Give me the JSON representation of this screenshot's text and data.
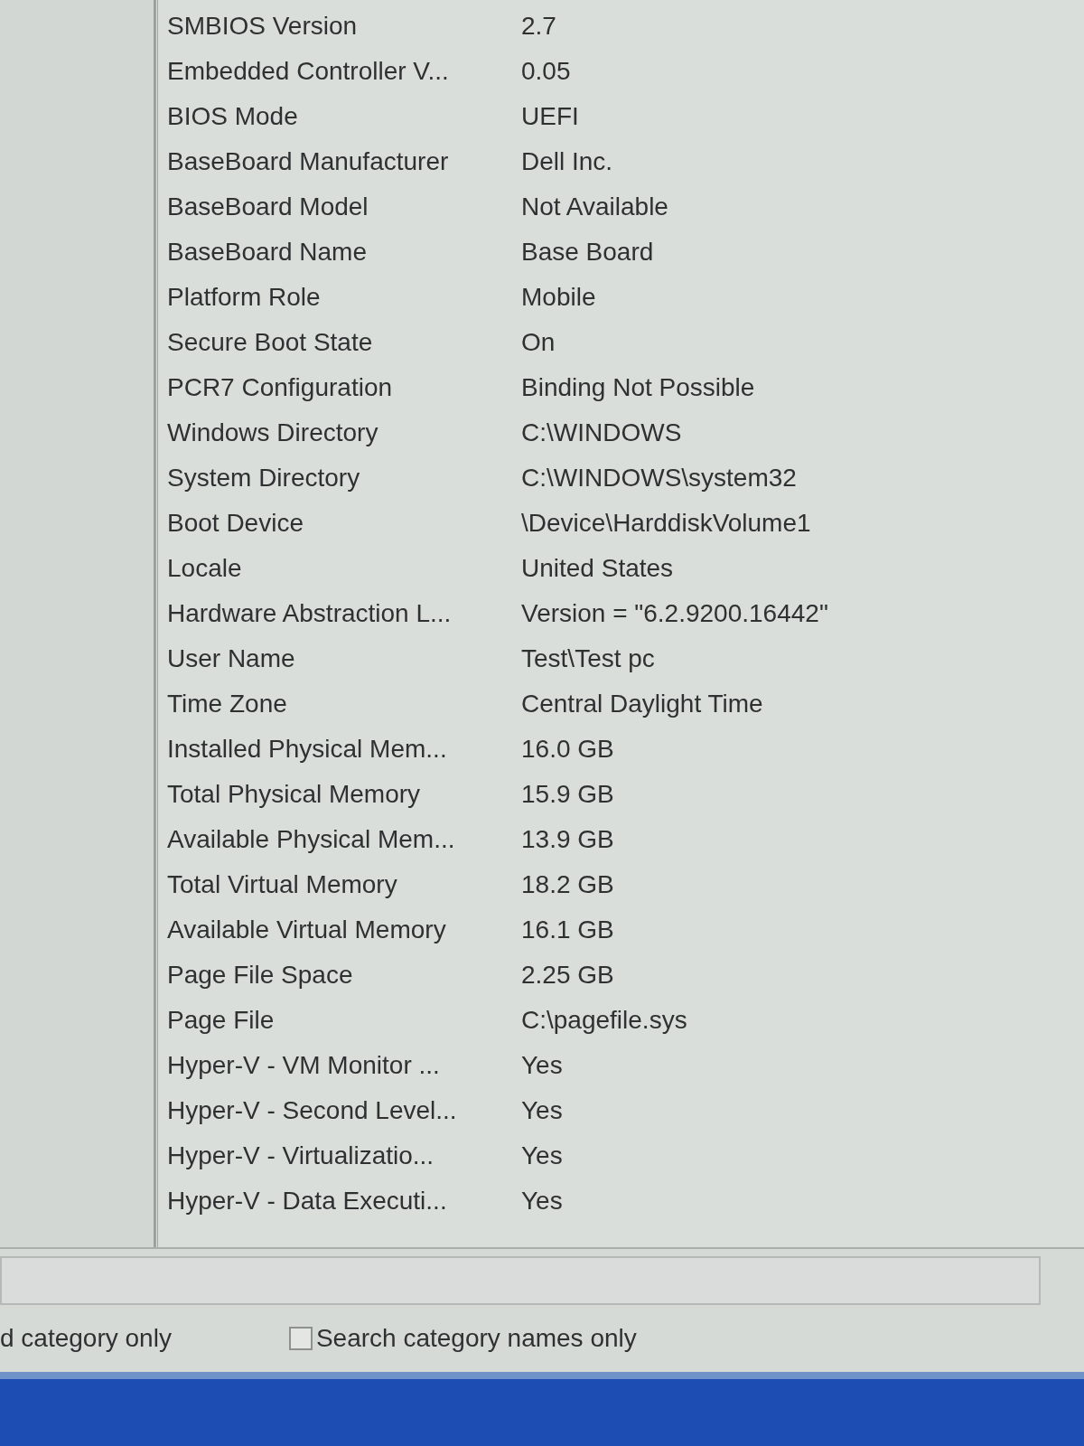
{
  "details": {
    "rows": [
      {
        "item": "SMBIOS Version",
        "value": "2.7"
      },
      {
        "item": "Embedded Controller V...",
        "value": "0.05"
      },
      {
        "item": "BIOS Mode",
        "value": "UEFI"
      },
      {
        "item": "BaseBoard Manufacturer",
        "value": "Dell Inc."
      },
      {
        "item": "BaseBoard Model",
        "value": "Not Available"
      },
      {
        "item": "BaseBoard Name",
        "value": "Base Board"
      },
      {
        "item": "Platform Role",
        "value": "Mobile"
      },
      {
        "item": "Secure Boot State",
        "value": "On"
      },
      {
        "item": "PCR7 Configuration",
        "value": "Binding Not Possible"
      },
      {
        "item": "Windows Directory",
        "value": "C:\\WINDOWS"
      },
      {
        "item": "System Directory",
        "value": "C:\\WINDOWS\\system32"
      },
      {
        "item": "Boot Device",
        "value": "\\Device\\HarddiskVolume1"
      },
      {
        "item": "Locale",
        "value": "United States"
      },
      {
        "item": "Hardware Abstraction L...",
        "value": "Version = \"6.2.9200.16442\""
      },
      {
        "item": "User Name",
        "value": "Test\\Test pc"
      },
      {
        "item": "Time Zone",
        "value": "Central Daylight Time"
      },
      {
        "item": "Installed Physical Mem...",
        "value": "16.0 GB"
      },
      {
        "item": "Total Physical Memory",
        "value": "15.9 GB"
      },
      {
        "item": "Available Physical Mem...",
        "value": "13.9 GB"
      },
      {
        "item": "Total Virtual Memory",
        "value": "18.2 GB"
      },
      {
        "item": "Available Virtual Memory",
        "value": "16.1 GB"
      },
      {
        "item": "Page File Space",
        "value": "2.25 GB"
      },
      {
        "item": "Page File",
        "value": "C:\\pagefile.sys"
      },
      {
        "item": "Hyper-V - VM Monitor ...",
        "value": "Yes"
      },
      {
        "item": "Hyper-V - Second Level...",
        "value": "Yes"
      },
      {
        "item": "Hyper-V - Virtualizatio...",
        "value": "Yes"
      },
      {
        "item": "Hyper-V - Data Executi...",
        "value": "Yes"
      }
    ]
  },
  "search_options": [
    {
      "kind": "text",
      "label": "d category only"
    },
    {
      "kind": "checkbox",
      "label": "Search category names only",
      "checked": false
    }
  ]
}
